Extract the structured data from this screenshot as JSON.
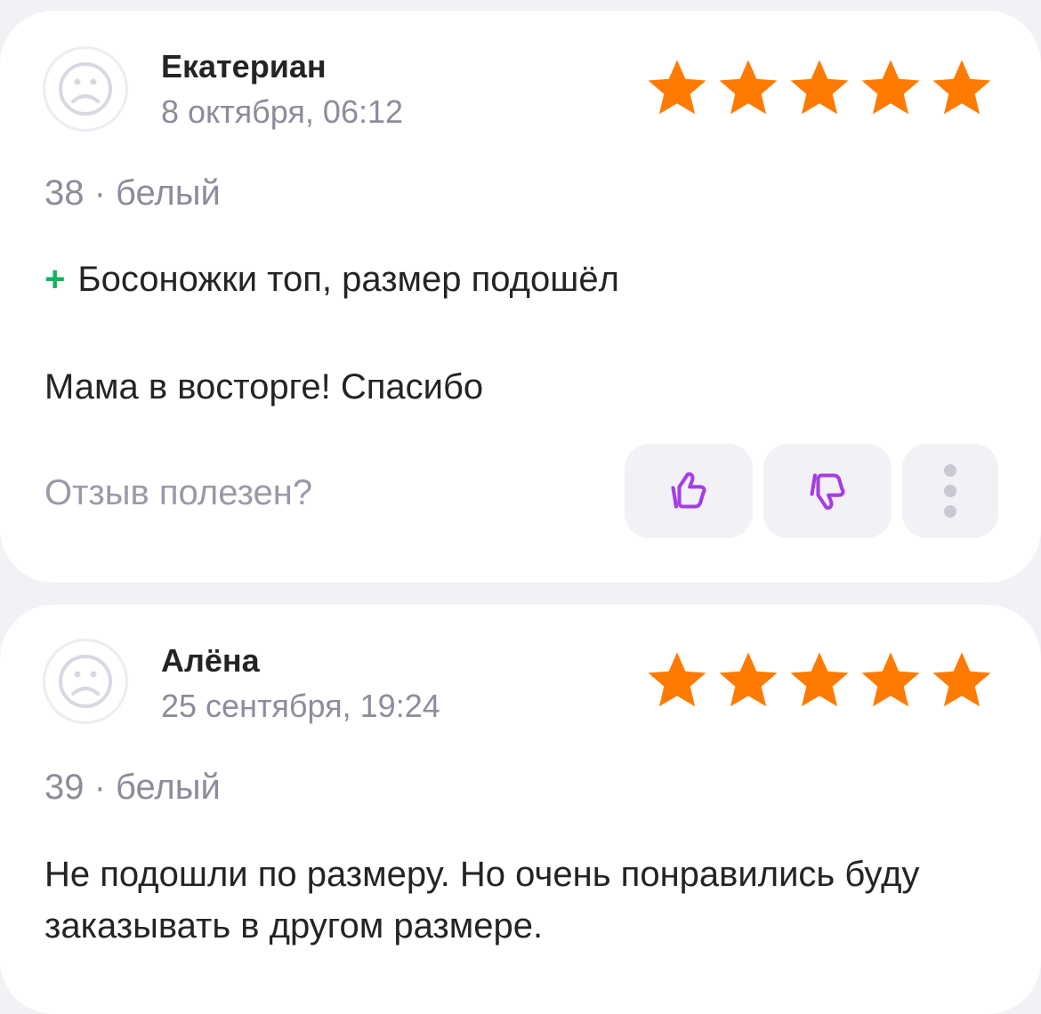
{
  "reviews": [
    {
      "author": "Екатериан",
      "date": "8 октября, 06:12",
      "rating": 5,
      "variant": "38 · белый",
      "pros_marker": "+",
      "pros": "Босоножки топ, размер подошёл",
      "comment": "Мама в восторге! Спасибо",
      "helpful_label": "Отзыв полезен?"
    },
    {
      "author": "Алёна",
      "date": "25 сентября, 19:24",
      "rating": 5,
      "variant": "39 · белый",
      "comment": "Не подошли по размеру. Но очень понравились буду заказывать в другом размере."
    }
  ],
  "icons": {
    "avatar": "sad-face-icon",
    "star": "star-icon",
    "like": "thumbs-up-icon",
    "dislike": "thumbs-down-icon",
    "more": "more-vertical-icon"
  },
  "colors": {
    "star": "#ff7a00",
    "vote_icon": "#a63ce6",
    "pros_plus": "#13b25e",
    "muted_text": "#8e8c9c",
    "button_bg": "#f1f1f6"
  }
}
